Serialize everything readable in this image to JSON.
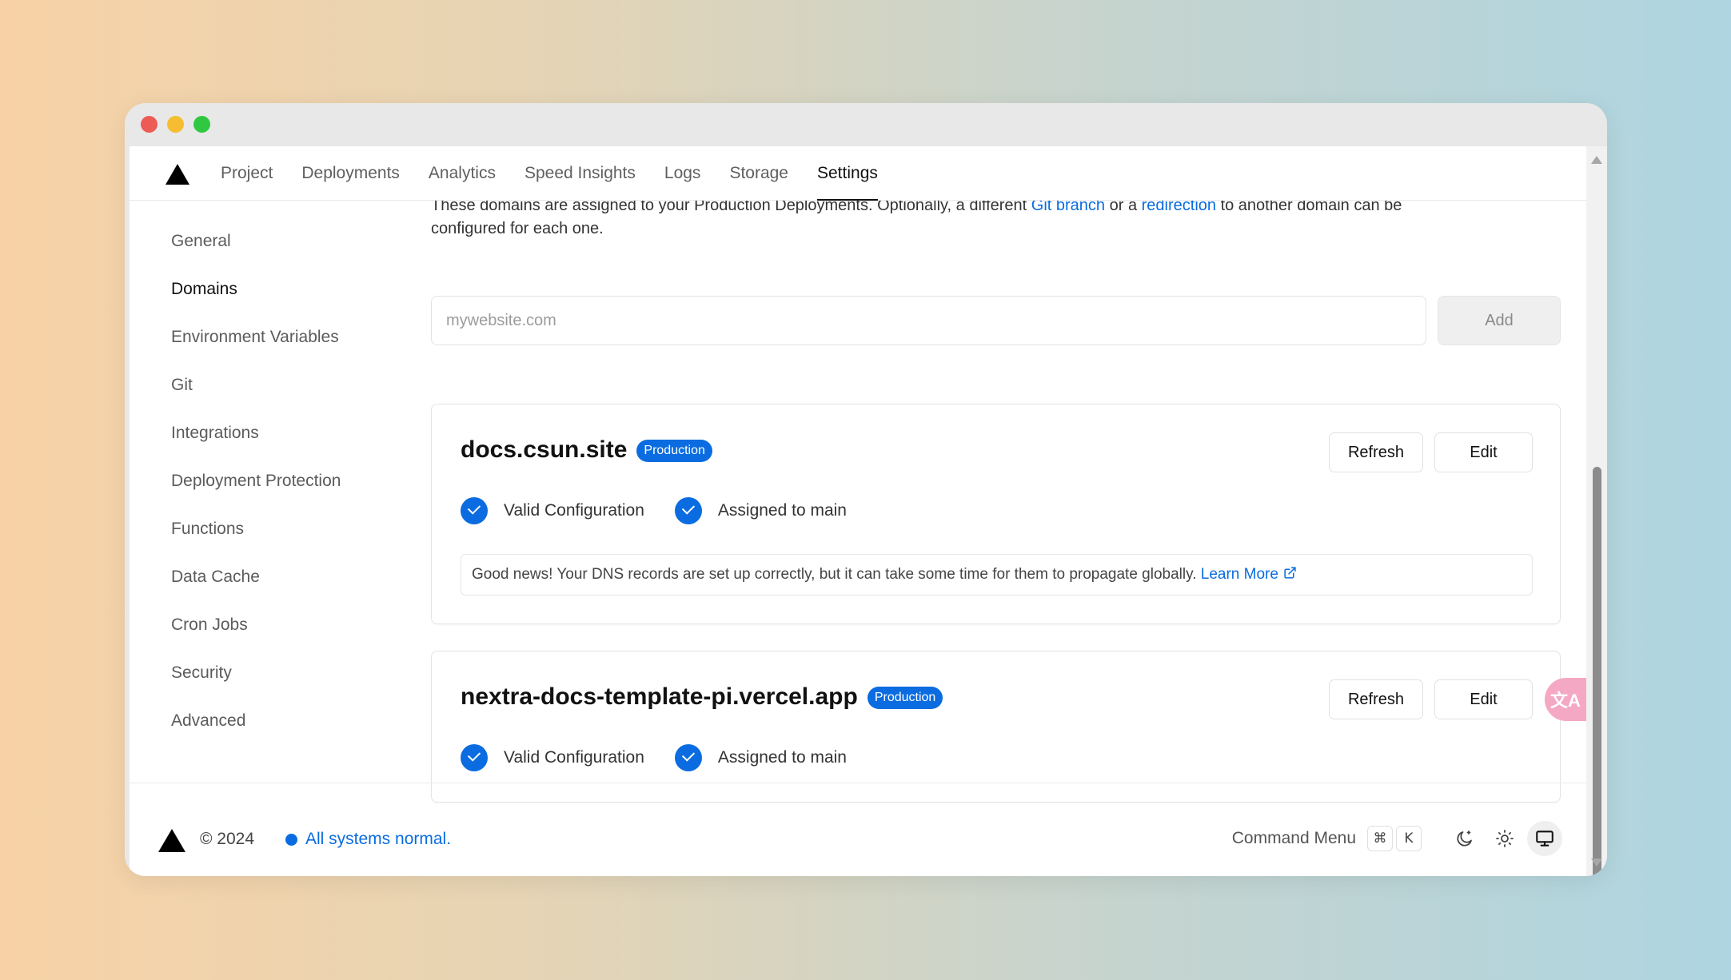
{
  "nav": {
    "tabs": [
      {
        "label": "Project"
      },
      {
        "label": "Deployments"
      },
      {
        "label": "Analytics"
      },
      {
        "label": "Speed Insights"
      },
      {
        "label": "Logs"
      },
      {
        "label": "Storage"
      },
      {
        "label": "Settings"
      }
    ],
    "active_tab": "Settings"
  },
  "sidebar": {
    "items": [
      {
        "label": "General"
      },
      {
        "label": "Domains"
      },
      {
        "label": "Environment Variables"
      },
      {
        "label": "Git"
      },
      {
        "label": "Integrations"
      },
      {
        "label": "Deployment Protection"
      },
      {
        "label": "Functions"
      },
      {
        "label": "Data Cache"
      },
      {
        "label": "Cron Jobs"
      },
      {
        "label": "Security"
      },
      {
        "label": "Advanced"
      }
    ],
    "active_item": "Domains"
  },
  "intro": {
    "text_a": "These domains are assigned to your Production Deployments. Optionally, a different ",
    "link_branch": "Git branch",
    "text_b": " or a ",
    "link_redirect": "redirection",
    "text_c": " to another domain can be",
    "line2": "configured for each one."
  },
  "add_domain": {
    "placeholder": "mywebsite.com",
    "value": "",
    "button_label": "Add"
  },
  "domains": [
    {
      "name": "docs.csun.site",
      "badge": "Production",
      "refresh_label": "Refresh",
      "edit_label": "Edit",
      "status_config": "Valid Configuration",
      "status_assign": "Assigned to main",
      "note_text": "Good news! Your DNS records are set up correctly, but it can take some time for them to propagate globally. ",
      "note_link": "Learn More"
    },
    {
      "name": "nextra-docs-template-pi.vercel.app",
      "badge": "Production",
      "refresh_label": "Refresh",
      "edit_label": "Edit",
      "status_config": "Valid Configuration",
      "status_assign": "Assigned to main"
    }
  ],
  "footer": {
    "copyright": "© 2024",
    "status_text": "All systems normal.",
    "command_menu_label": "Command Menu",
    "shortcut_keys": [
      "⌘",
      "K"
    ]
  },
  "floating": {
    "translate_glyph": "文A"
  },
  "colors": {
    "accent": "#0a6ce0",
    "text_primary": "#111111",
    "text_secondary": "#5b5b5b"
  },
  "icons": [
    "vercel-logo-icon",
    "check-circle-icon",
    "external-link-icon",
    "moon-icon",
    "sun-icon",
    "monitor-icon",
    "translate-icon"
  ]
}
